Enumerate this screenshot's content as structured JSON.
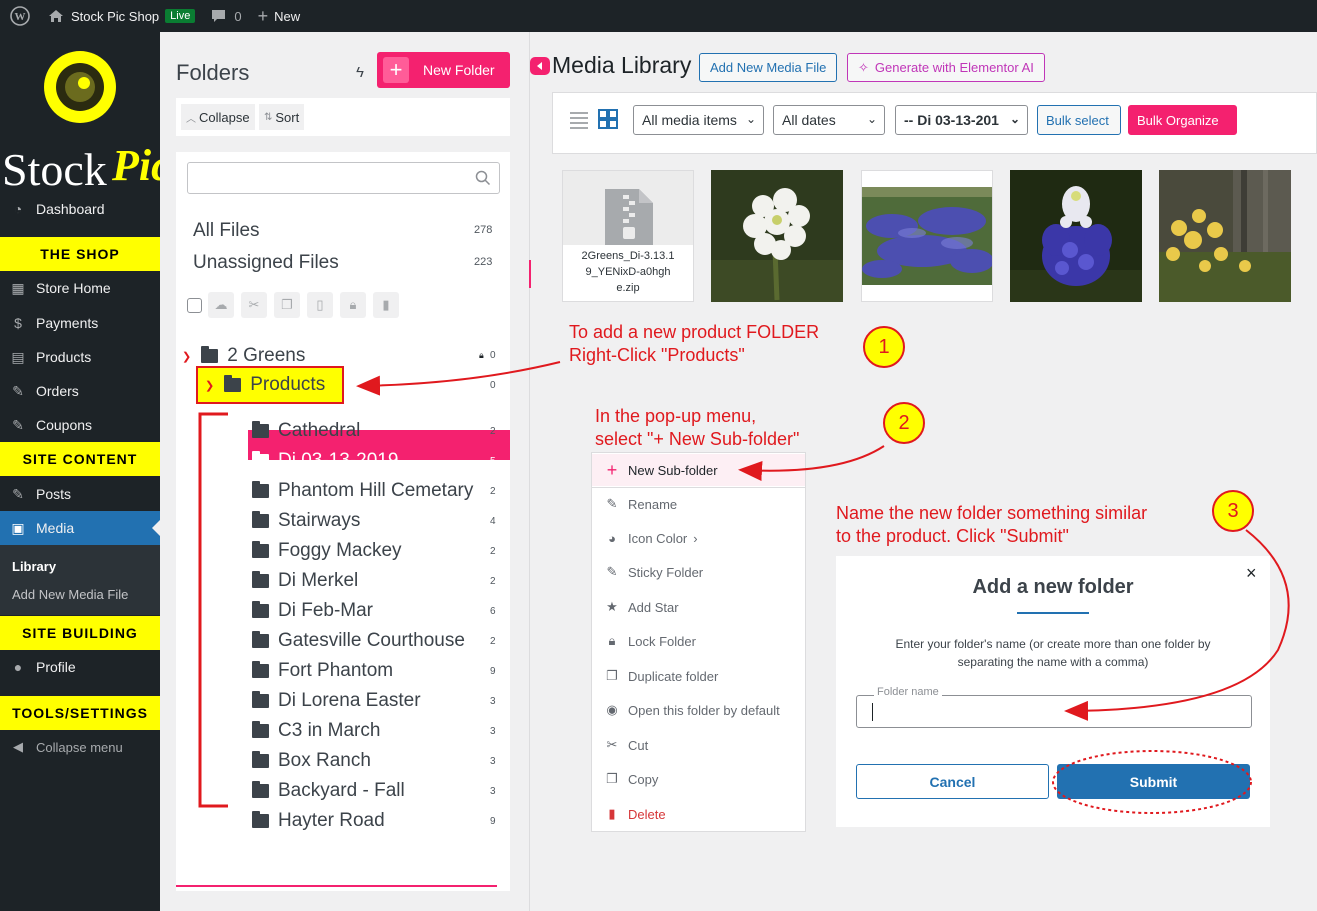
{
  "adminbar": {
    "site_name": "Stock Pic Shop",
    "live_badge": "Live",
    "comments_count": "0",
    "new_label": "New"
  },
  "sidebar": {
    "logo_text": "StockPic",
    "dashboard": "Dashboard",
    "section_shop": "THE SHOP",
    "store_home": "Store Home",
    "payments": "Payments",
    "products": "Products",
    "orders": "Orders",
    "coupons": "Coupons",
    "section_content": "SITE CONTENT",
    "posts": "Posts",
    "media": "Media",
    "library": "Library",
    "add_new_media": "Add New Media File",
    "section_building": "SITE BUILDING",
    "profile": "Profile",
    "section_tools": "TOOLS/SETTINGS",
    "collapse_menu": "Collapse menu"
  },
  "folders": {
    "title": "Folders",
    "new_folder": "New Folder",
    "collapse": "Collapse",
    "sort": "Sort",
    "all_files": "All Files",
    "all_files_count": "278",
    "unassigned": "Unassigned Files",
    "unassigned_count": "223",
    "root": {
      "name": "2 Greens",
      "count": "0"
    },
    "products": {
      "name": "Products",
      "count": "0"
    },
    "children": [
      {
        "name": "Cathedral",
        "count": "2"
      },
      {
        "name": "Di 03-13-2019",
        "count": "5"
      },
      {
        "name": "Phantom Hill Cemetary",
        "count": "2"
      },
      {
        "name": "Stairways",
        "count": "4"
      },
      {
        "name": "Foggy Mackey",
        "count": "2"
      },
      {
        "name": "Di Merkel",
        "count": "2"
      },
      {
        "name": "Di Feb-Mar",
        "count": "6"
      },
      {
        "name": "Gatesville Courthouse",
        "count": "2"
      },
      {
        "name": "Fort Phantom",
        "count": "9"
      },
      {
        "name": "Di Lorena Easter",
        "count": "3"
      },
      {
        "name": "C3 in March",
        "count": "3"
      },
      {
        "name": "Box Ranch",
        "count": "3"
      },
      {
        "name": "Backyard - Fall",
        "count": "3"
      },
      {
        "name": "Hayter Road",
        "count": "9"
      }
    ]
  },
  "media": {
    "title": "Media Library",
    "add_new": "Add New Media File",
    "generate_ai": "Generate with Elementor AI",
    "filter_items": "All media items",
    "filter_dates": "All dates",
    "filter_folder": "-- Di 03-13-201",
    "bulk_select": "Bulk select",
    "bulk_organize": "Bulk Organize",
    "zip_name": "2Greens_Di-3.13.19_YENixD-a0hghe.zip"
  },
  "context_menu": {
    "new_subfolder": "New Sub-folder",
    "rename": "Rename",
    "icon_color": "Icon Color",
    "sticky": "Sticky Folder",
    "add_star": "Add Star",
    "lock": "Lock Folder",
    "duplicate": "Duplicate folder",
    "open_default": "Open this folder by default",
    "cut": "Cut",
    "copy": "Copy",
    "delete": "Delete"
  },
  "dialog": {
    "title": "Add a new folder",
    "close": "×",
    "description": "Enter your folder's name (or create more than one folder by separating the name with a comma)",
    "input_label": "Folder name",
    "input_value": "",
    "cancel": "Cancel",
    "submit": "Submit"
  },
  "annotations": {
    "step1_line1": "To add a new product FOLDER",
    "step1_line2": "Right-Click \"Products\"",
    "step2_line1": "In the pop-up menu,",
    "step2_line2": "select \"+ New Sub-folder\"",
    "step3_line1": "Name the new folder something similar",
    "step3_line2": "to the product. Click \"Submit\"",
    "step1_num": "1",
    "step2_num": "2",
    "step3_num": "3"
  },
  "colors": {
    "accent_pink": "#f4216f",
    "wp_blue": "#2271b1",
    "highlight_yellow": "#ffff00",
    "annotation_red": "#e0191e"
  }
}
